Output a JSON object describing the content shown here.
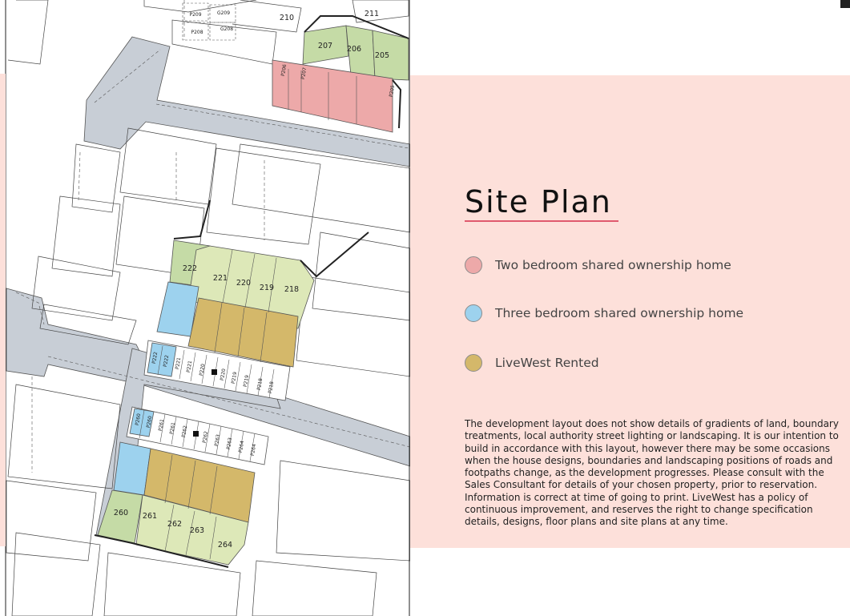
{
  "panel": {
    "title": "Site Plan",
    "legend": [
      {
        "label": "Two bedroom shared ownership home",
        "color": "#eda9a9"
      },
      {
        "label": "Three bedroom shared ownership home",
        "color": "#9dd2ee"
      },
      {
        "label": "LiveWest Rented",
        "color": "#d4b86a"
      }
    ],
    "disclaimer": "The development layout does not show details of gradients of land, boundary treatments, local authority street lighting or landscaping. It is our intention to build in accordance with this layout, however there may be some occasions when the house designs, boundaries and landscaping positions of roads and footpaths change, as the development progresses. Please consult with the Sales Consultant for details of your chosen property, prior to reservation. Information is correct at time of going to print. LiveWest has a policy of continuous improvement, and reserves the right to change specification details, designs, floor plans and site plans at any time."
  },
  "map": {
    "colors": {
      "road": "#c8ced6",
      "green": "#c5dba6",
      "pale_green": "#dde8b8",
      "pink": "#eda9a9",
      "blue": "#9dd2ee",
      "gold": "#d4b86a"
    },
    "plots": [
      {
        "label": "207"
      },
      {
        "label": "206"
      },
      {
        "label": "205"
      },
      {
        "label": "211"
      },
      {
        "label": "210"
      },
      {
        "label": "222"
      },
      {
        "label": "221"
      },
      {
        "label": "220"
      },
      {
        "label": "219"
      },
      {
        "label": "218"
      },
      {
        "label": "260"
      },
      {
        "label": "261"
      },
      {
        "label": "262"
      },
      {
        "label": "263"
      },
      {
        "label": "264"
      }
    ],
    "parking": [
      {
        "label": "P209"
      },
      {
        "label": "G209"
      },
      {
        "label": "P208"
      },
      {
        "label": "G208"
      },
      {
        "label": "P206"
      },
      {
        "label": "P207"
      },
      {
        "label": "P205"
      },
      {
        "label": "P222"
      },
      {
        "label": "P222"
      },
      {
        "label": "P221"
      },
      {
        "label": "P221"
      },
      {
        "label": "P220"
      },
      {
        "label": "P220"
      },
      {
        "label": "P219"
      },
      {
        "label": "P219"
      },
      {
        "label": "P218"
      },
      {
        "label": "P218"
      },
      {
        "label": "P260"
      },
      {
        "label": "P260"
      },
      {
        "label": "P261"
      },
      {
        "label": "P261"
      },
      {
        "label": "P262"
      },
      {
        "label": "P262"
      },
      {
        "label": "P263"
      },
      {
        "label": "P263"
      },
      {
        "label": "P264"
      },
      {
        "label": "P264"
      }
    ]
  }
}
